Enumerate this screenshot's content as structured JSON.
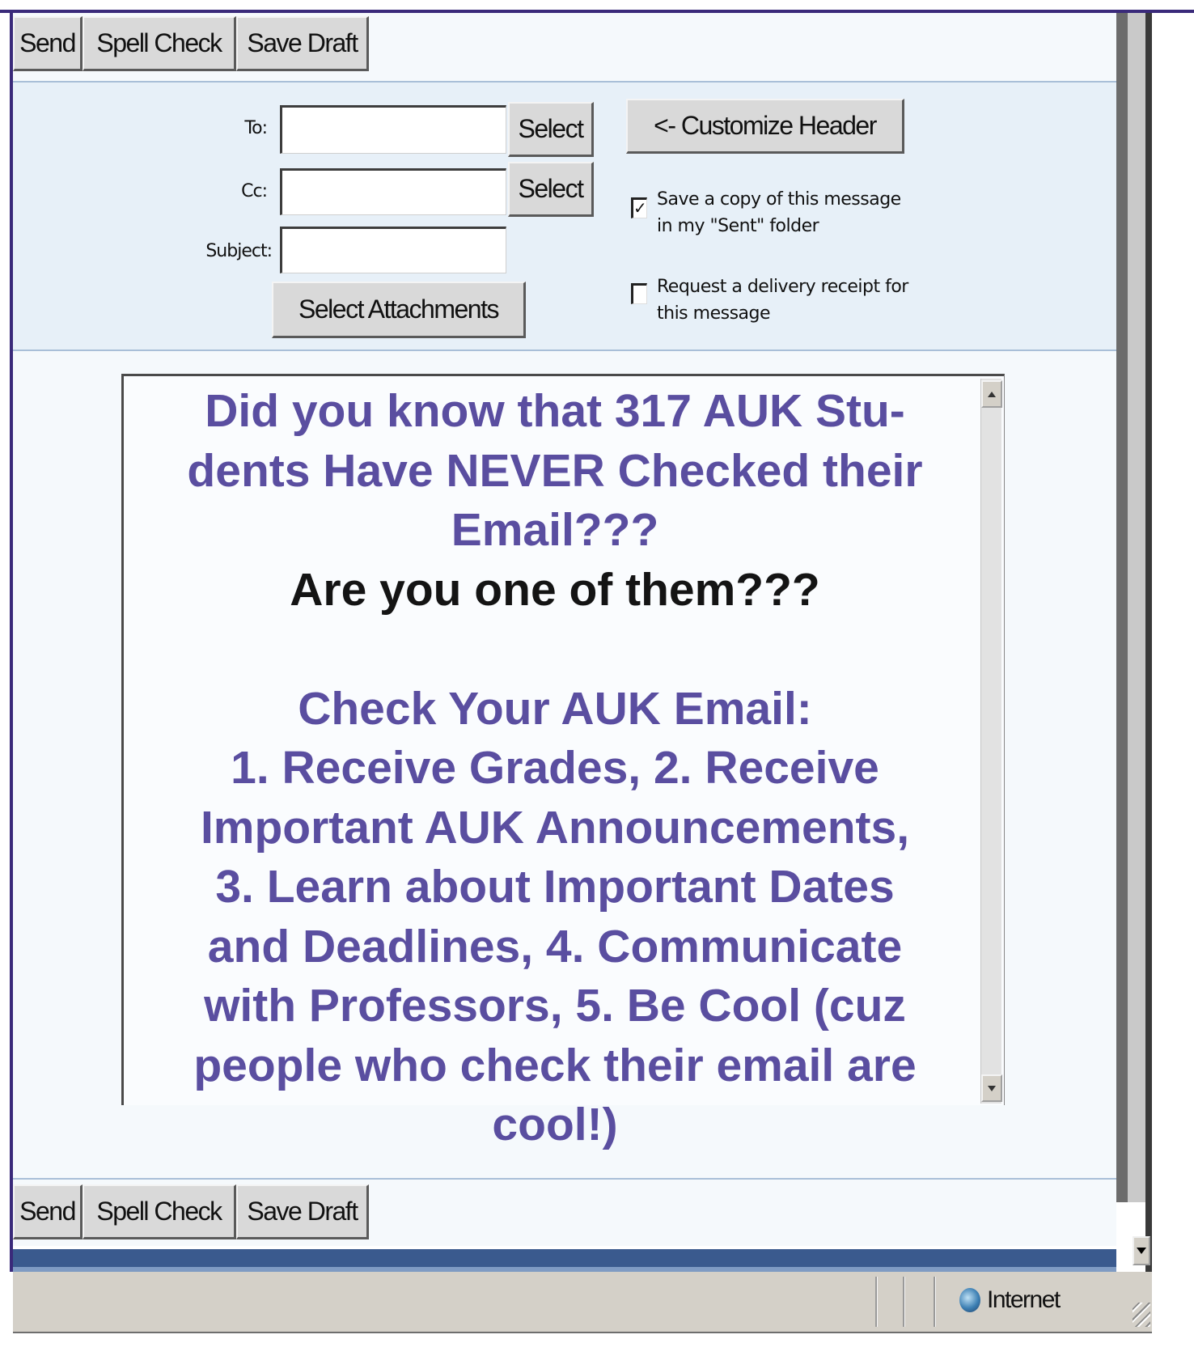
{
  "toolbar_top": {
    "send": "Send",
    "spell_check": "Spell Check",
    "save_draft": "Save Draft"
  },
  "header": {
    "to_label": "To:",
    "cc_label": "Cc:",
    "subject_label": "Subject:",
    "to_value": "",
    "cc_value": "",
    "subject_value": "",
    "select_to": "Select",
    "select_cc": "Select",
    "select_attachments": "Select Attachments",
    "customize_header": "<- Customize Header",
    "save_copy_checked": true,
    "save_copy_line1": "Save a copy of this message",
    "save_copy_line2": "in my \"Sent\" folder",
    "receipt_checked": false,
    "receipt_line1": "Request a delivery receipt for",
    "receipt_line2": "this message"
  },
  "message": {
    "line1": "Did you know that 317 AUK Stu-",
    "line2": "dents Have NEVER Checked their",
    "line3": "Email???",
    "line4": "Are you one of them???",
    "line5": "Check Your AUK Email:",
    "line6": "1. Receive Grades, 2. Receive",
    "line7": "Important AUK Announcements,",
    "line8": "3. Learn about Important Dates",
    "line9": "and Deadlines, 4. Communicate",
    "line10": "with Professors, 5. Be Cool (cuz",
    "line11": "people who check their email are",
    "line12": "cool!)"
  },
  "toolbar_bottom": {
    "send": "Send",
    "spell_check": "Spell Check",
    "save_draft": "Save Draft"
  },
  "status_bar": {
    "zone": "Internet",
    "zone_icon": "globe-icon"
  },
  "colors": {
    "message_text": "#5a4ea0",
    "frame": "#3a2a7a",
    "header_bg": "#e7f0f8"
  }
}
